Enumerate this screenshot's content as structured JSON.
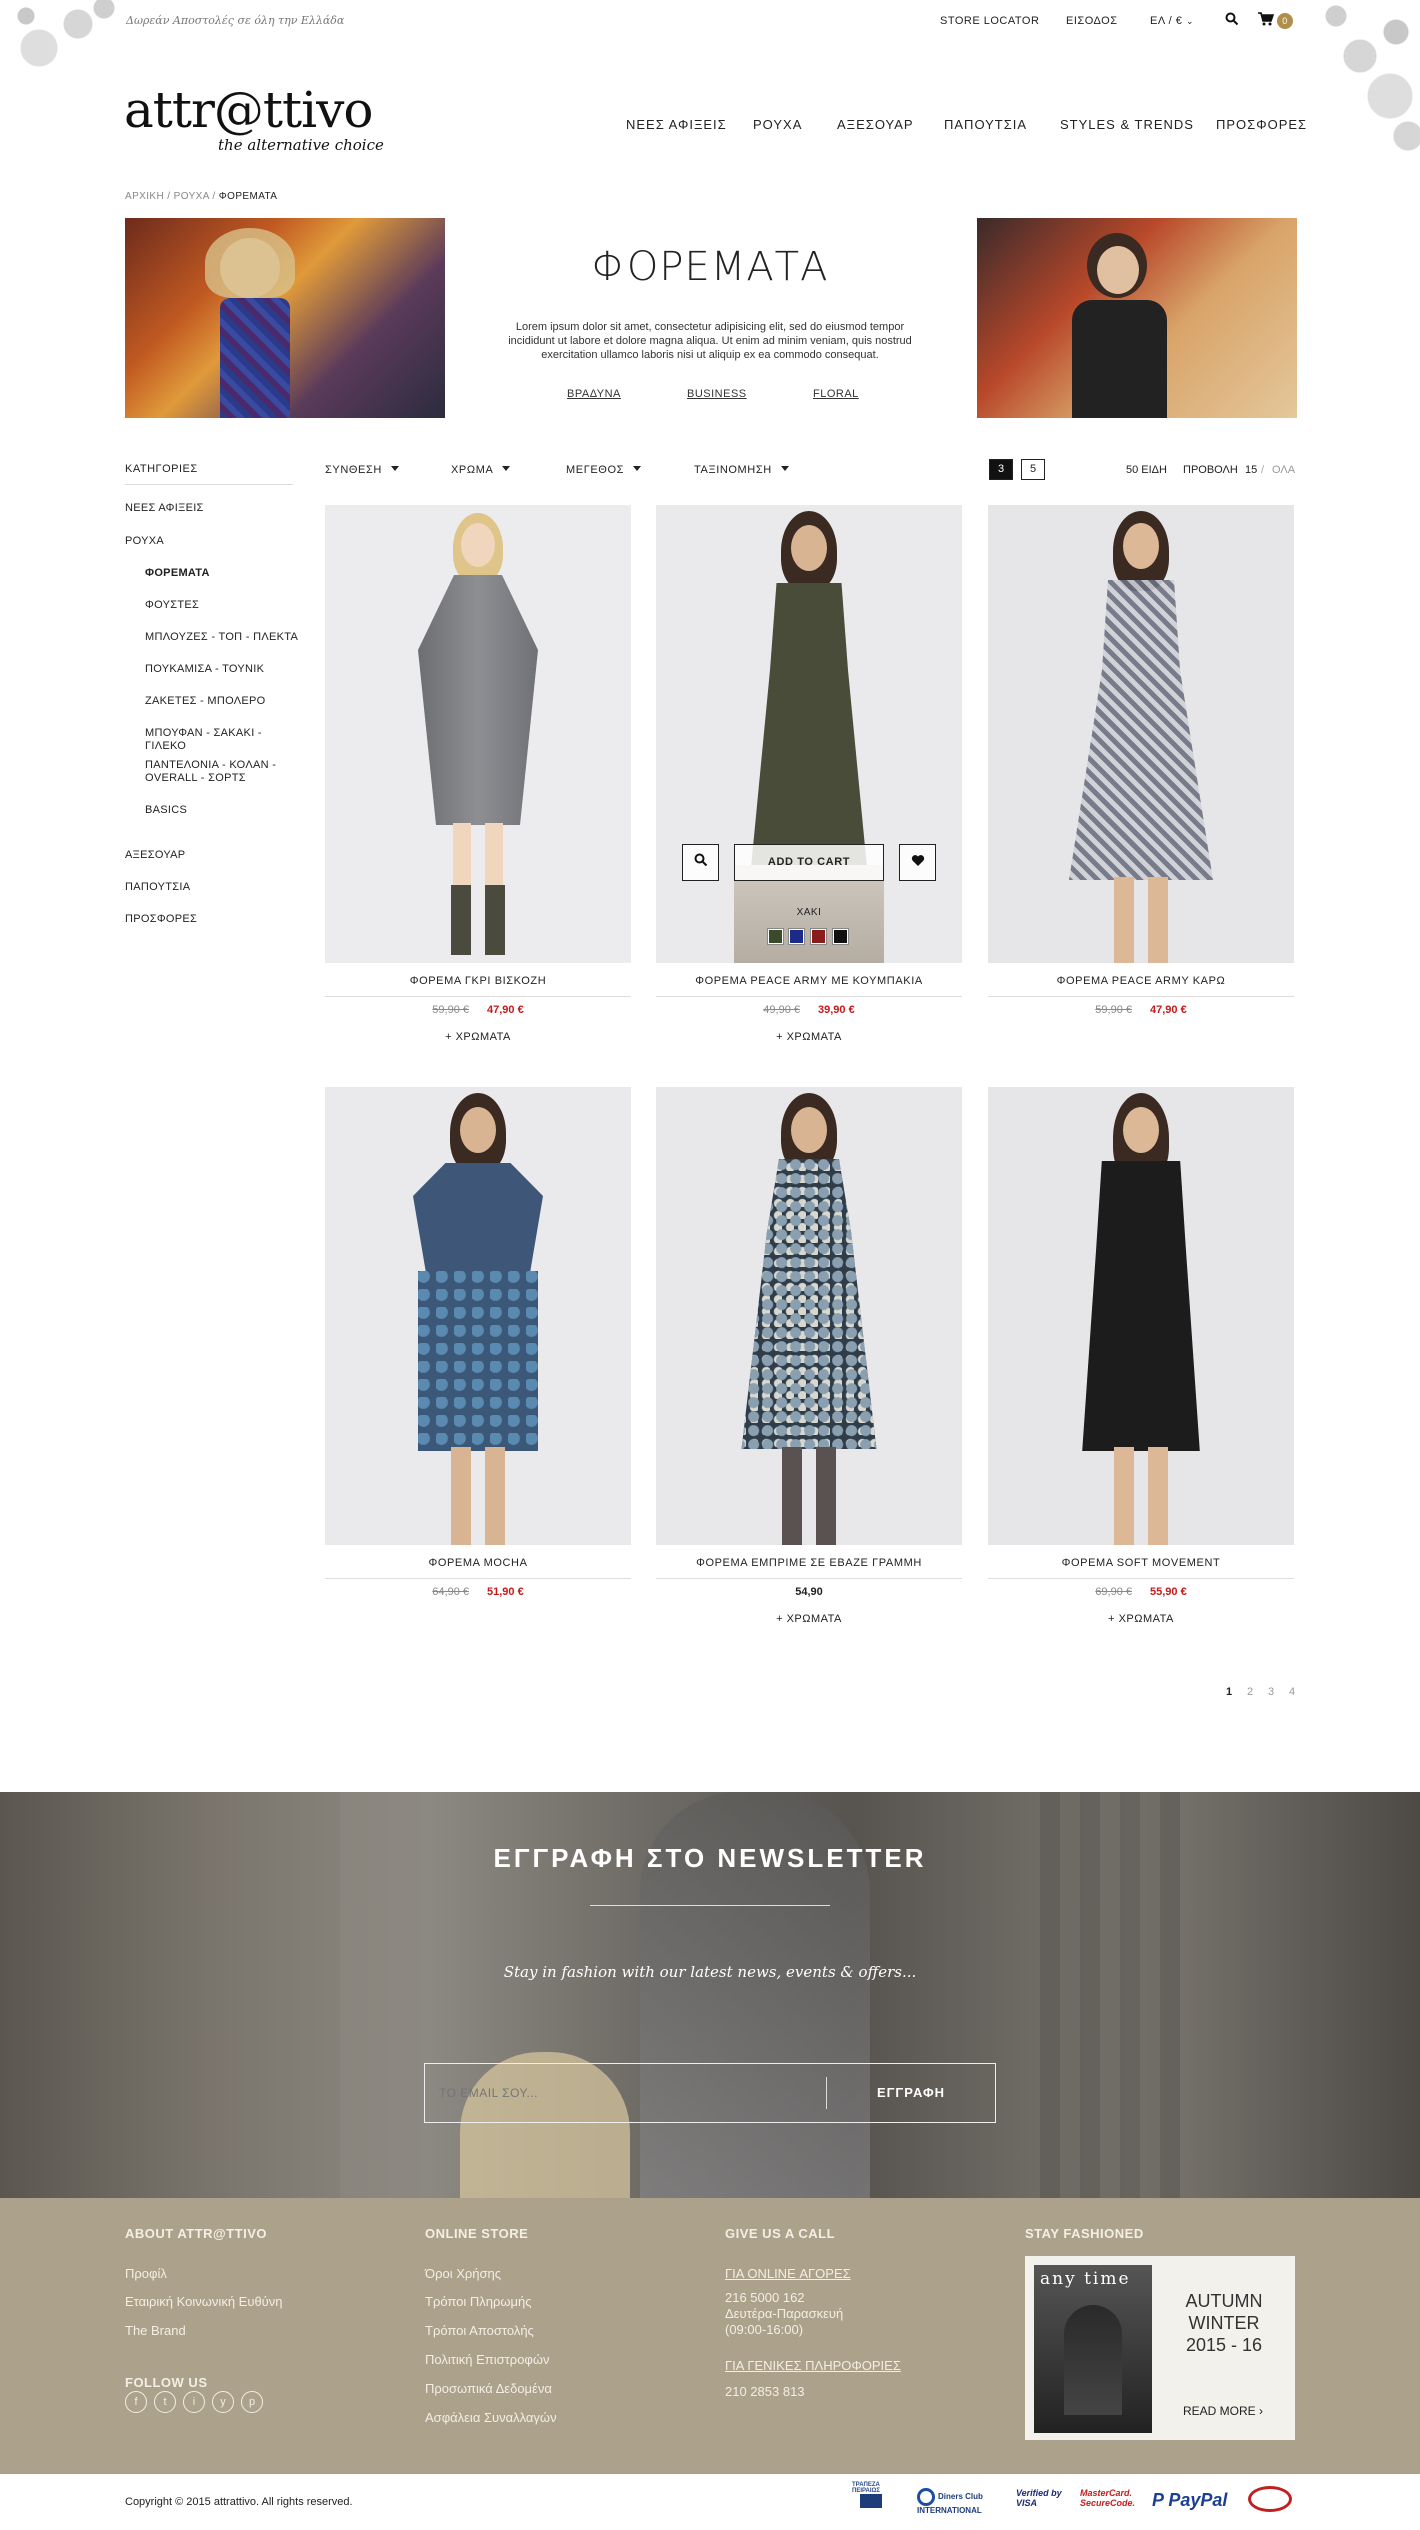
{
  "topbar": {
    "promo": "Δωρεάν Αποστολές σε όλη την Ελλάδα",
    "store_locator": "STORE LOCATOR",
    "login": "ΕΙΣΟΔΟΣ",
    "lang": "ΕΛ / €",
    "cart_count": "0"
  },
  "header": {
    "logo": "attr@ttivo",
    "tagline": "the alternative choice",
    "nav": [
      "ΝΕΕΣ ΑΦΙΞΕΙΣ",
      "ΡΟΥΧΑ",
      "ΑΞΕΣΟΥΑΡ",
      "ΠΑΠΟΥΤΣΙΑ",
      "STYLES & TRENDS",
      "ΠΡΟΣΦΟΡΕΣ"
    ]
  },
  "breadcrumb": [
    "ΑΡΧΙΚΗ",
    "ΡΟΥΧΑ",
    "ΦΟΡΕΜΑΤΑ"
  ],
  "banner": {
    "title": "ΦΟΡΕΜΑΤΑ",
    "description": "Lorem ipsum dolor sit amet, consectetur adipisicing elit, sed do eiusmod tempor incididunt ut labore et dolore magna aliqua. Ut enim ad minim veniam, quis nostrud exercitation ullamco laboris nisi ut aliquip ex ea commodo consequat.",
    "links": [
      "ΒΡΑΔΥΝΑ",
      "BUSINESS",
      "FLORAL"
    ]
  },
  "sidebar": {
    "heading": "ΚΑΤΗΓΟΡΙΕΣ",
    "items": [
      "ΝΕΕΣ ΑΦΙΞΕΙΣ",
      "ΡΟΥΧΑ",
      "ΦΟΡΕΜΑΤΑ",
      "ΦΟΥΣΤΕΣ",
      "ΜΠΛΟΥΖΕΣ - ΤΟΠ - ΠΛΕΚΤΑ",
      "ΠΟΥΚΑΜΙΣΑ - ΤΟΥΝΙΚ",
      "ΖΑΚΕΤΕΣ - ΜΠΟΛΕΡΟ",
      "ΜΠΟΥΦΑΝ - ΣΑΚΑΚΙ - ΓΙΛΕΚΟ",
      "ΠΑΝΤΕΛΟΝΙΑ - ΚΟΛΑΝ - OVERALL - ΣΟΡΤΣ",
      "BASICS",
      "ΑΞΕΣΟΥΑΡ",
      "ΠΑΠΟΥΤΣΙΑ",
      "ΠΡΟΣΦΟΡΕΣ"
    ]
  },
  "filters": {
    "composition": "ΣΥΝΘΕΣΗ",
    "color": "ΧΡΩΜΑ",
    "size": "ΜΕΓΕΘΟΣ",
    "sort": "ΤΑΞΙΝΟΜΗΣΗ",
    "grid3": "3",
    "grid5": "5",
    "count": "50 ΕΙΔΗ",
    "view_label": "ΠΡΟΒΟΛΗ",
    "view_15": "15",
    "view_all": "ΟΛΑ"
  },
  "products": [
    {
      "name": "ΦΟΡΕΜΑ ΓΚΡΙ ΒΙΣΚΟΖΗ",
      "old_price": "59,90 €",
      "price": "47,90 €",
      "colors": "+ ΧΡΩΜΑΤΑ"
    },
    {
      "name": "ΦΟΡΕΜΑ PEACE ARMY ΜΕ ΚΟΥΜΠΑΚΙΑ",
      "old_price": "49,90 €",
      "price": "39,90 €",
      "colors": "+ ΧΡΩΜΑΤΑ"
    },
    {
      "name": "ΦΟΡΕΜΑ PEACE ARMY ΚΑΡΩ",
      "old_price": "59,90 €",
      "price": "47,90 €",
      "colors": ""
    },
    {
      "name": "ΦΟΡΕΜΑ MOCHA",
      "old_price": "64,90 €",
      "price": "51,90 €",
      "colors": ""
    },
    {
      "name": "ΦΟΡΕΜΑ ΕΜΠΡΙΜΕ ΣΕ ΕΒΑΖΕ ΓΡΑΜΜΗ",
      "old_price": "",
      "price": "54,90",
      "colors": "+ ΧΡΩΜΑΤΑ"
    },
    {
      "name": "ΦΟΡΕΜΑ SOFT MOVEMENT",
      "old_price": "69,90 €",
      "price": "55,90 €",
      "colors": "+ ΧΡΩΜΑΤΑ"
    }
  ],
  "quickview": {
    "add_to_cart": "ADD TO CART",
    "color_name": "ΧΑΚΙ",
    "swatches": [
      "#3a4a2a",
      "#1c2a8a",
      "#8a1c1c",
      "#111111"
    ]
  },
  "pagination": [
    "1",
    "2",
    "3",
    "4"
  ],
  "newsletter": {
    "title": "ΕΓΓΡΑΦΗ ΣΤΟ NEWSLETTER",
    "subtitle": "Stay in fashion with our latest news, events & offers...",
    "placeholder": "ΤΟ EMAIL ΣΟΥ...",
    "button": "ΕΓΓΡΑΦΗ"
  },
  "footer": {
    "about": {
      "heading": "ABOUT ATTR@TTIVO",
      "links": [
        "Προφίλ",
        "Εταιρική Κοινωνική Ευθύνη",
        "The Brand"
      ]
    },
    "follow": "FOLLOW US",
    "social": [
      "f",
      "t",
      "i",
      "y",
      "p"
    ],
    "store": {
      "heading": "ONLINE STORE",
      "links": [
        "Όροι Χρήσης",
        "Τρόποι Πληρωμής",
        "Τρόποι Αποστολής",
        "Πολιτική Επιστροφών",
        "Προσωπικά Δεδομένα",
        "Ασφάλεια Συναλλαγών"
      ]
    },
    "call": {
      "heading": "GIVE US A CALL",
      "online_label": "ΓΙΑ ONLINE ΑΓΟΡΕΣ",
      "online_phone": "216 5000 162",
      "online_days": "Δευτέρα-Παρασκευή",
      "online_hours": "(09:00-16:00)",
      "general_label": "ΓΙΑ ΓΕΝΙΚΕΣ ΠΛΗΡΟΦΟΡΙΕΣ",
      "general_phone": "210 2853 813"
    },
    "fashioned": {
      "heading": "STAY FASHIONED",
      "cover_brand": "any time",
      "season_1": "AUTUMN",
      "season_2": "WINTER",
      "season_3": "2015 - 16",
      "read_more": "READ MORE"
    }
  },
  "bottom": {
    "copyright": "Copyright © 2015 attrattivo. All rights reserved.",
    "payments": [
      "ΤΡΑΠΕΖΑ ΠΕΙΡΑΙΩΣ",
      "Diners Club INTERNATIONAL",
      "Verified by VISA",
      "MasterCard. SecureCode.",
      "PayPal"
    ]
  }
}
